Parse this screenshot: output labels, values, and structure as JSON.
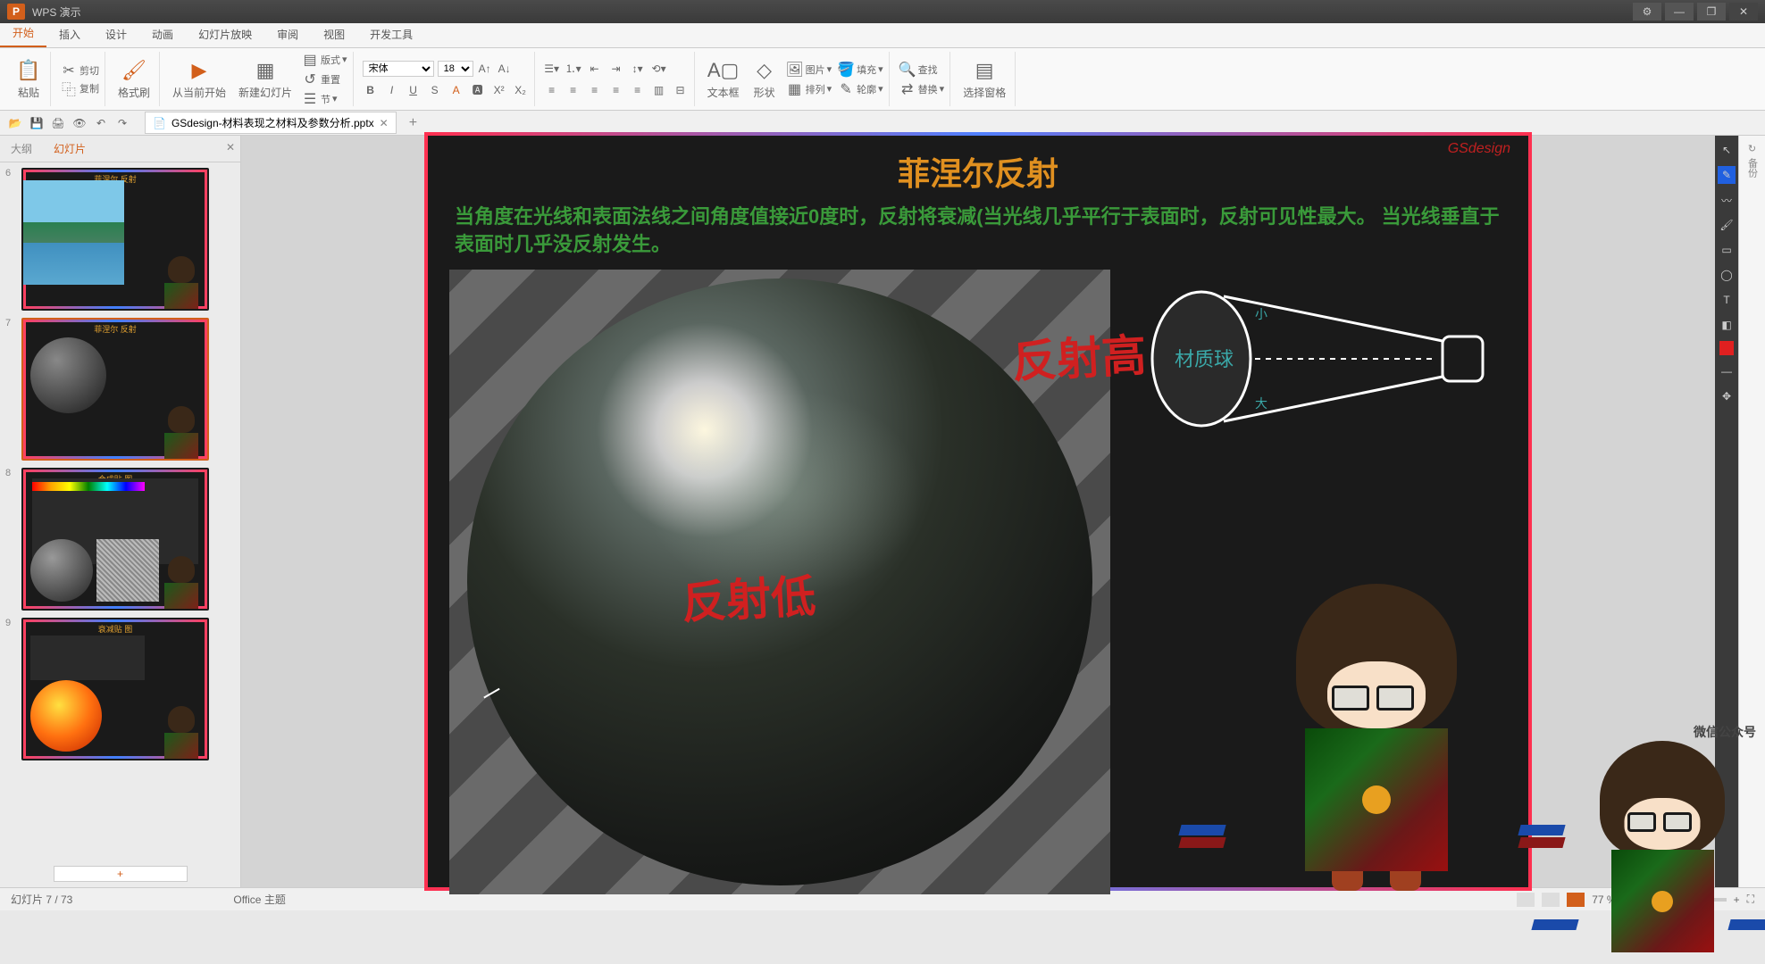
{
  "app": {
    "name": "WPS 演示"
  },
  "window": {
    "min": "—",
    "max": "❐",
    "close": "✕"
  },
  "tabs": [
    "开始",
    "插入",
    "设计",
    "动画",
    "幻灯片放映",
    "审阅",
    "视图",
    "开发工具"
  ],
  "ribbon": {
    "paste": "粘贴",
    "cut": "剪切",
    "copy": "复制",
    "format_painter": "格式刷",
    "from_current": "从当前开始",
    "new_slide": "新建幻灯片",
    "layout": "版式",
    "section": "节",
    "font": "宋体",
    "size": "18",
    "reset": "重置",
    "textbox": "文本框",
    "shape": "形状",
    "image": "图片",
    "arrange": "排列",
    "fill": "填充",
    "outline": "轮廓",
    "find": "查找",
    "replace": "替换",
    "select_pane": "选择窗格"
  },
  "doc": {
    "filename": "GSdesign-材料表现之材料及参数分析.pptx"
  },
  "side": {
    "outline": "大纲",
    "slides": "幻灯片"
  },
  "thumbs": [
    {
      "num": "6"
    },
    {
      "num": "7"
    },
    {
      "num": "8"
    },
    {
      "num": "9"
    }
  ],
  "slide": {
    "brand": "GSdesign",
    "title": "菲涅尔反射",
    "desc": "当角度在光线和表面法线之间角度值接近0度时，反射将衰减(当光线几乎平行于表面时，反射可见性最大。 当光线垂直于表面时几乎没反射发生。",
    "ann_high": "反射高",
    "ann_low": "反射低",
    "diag_label": "材质球",
    "diag_small1": "小",
    "diag_small2": "大"
  },
  "backup": {
    "icon": "↻",
    "label": "备份"
  },
  "status": {
    "slide_pos": "幻灯片 7 / 73",
    "theme": "Office 主题",
    "zoom": "77 %",
    "wechat": "微信公众号"
  }
}
